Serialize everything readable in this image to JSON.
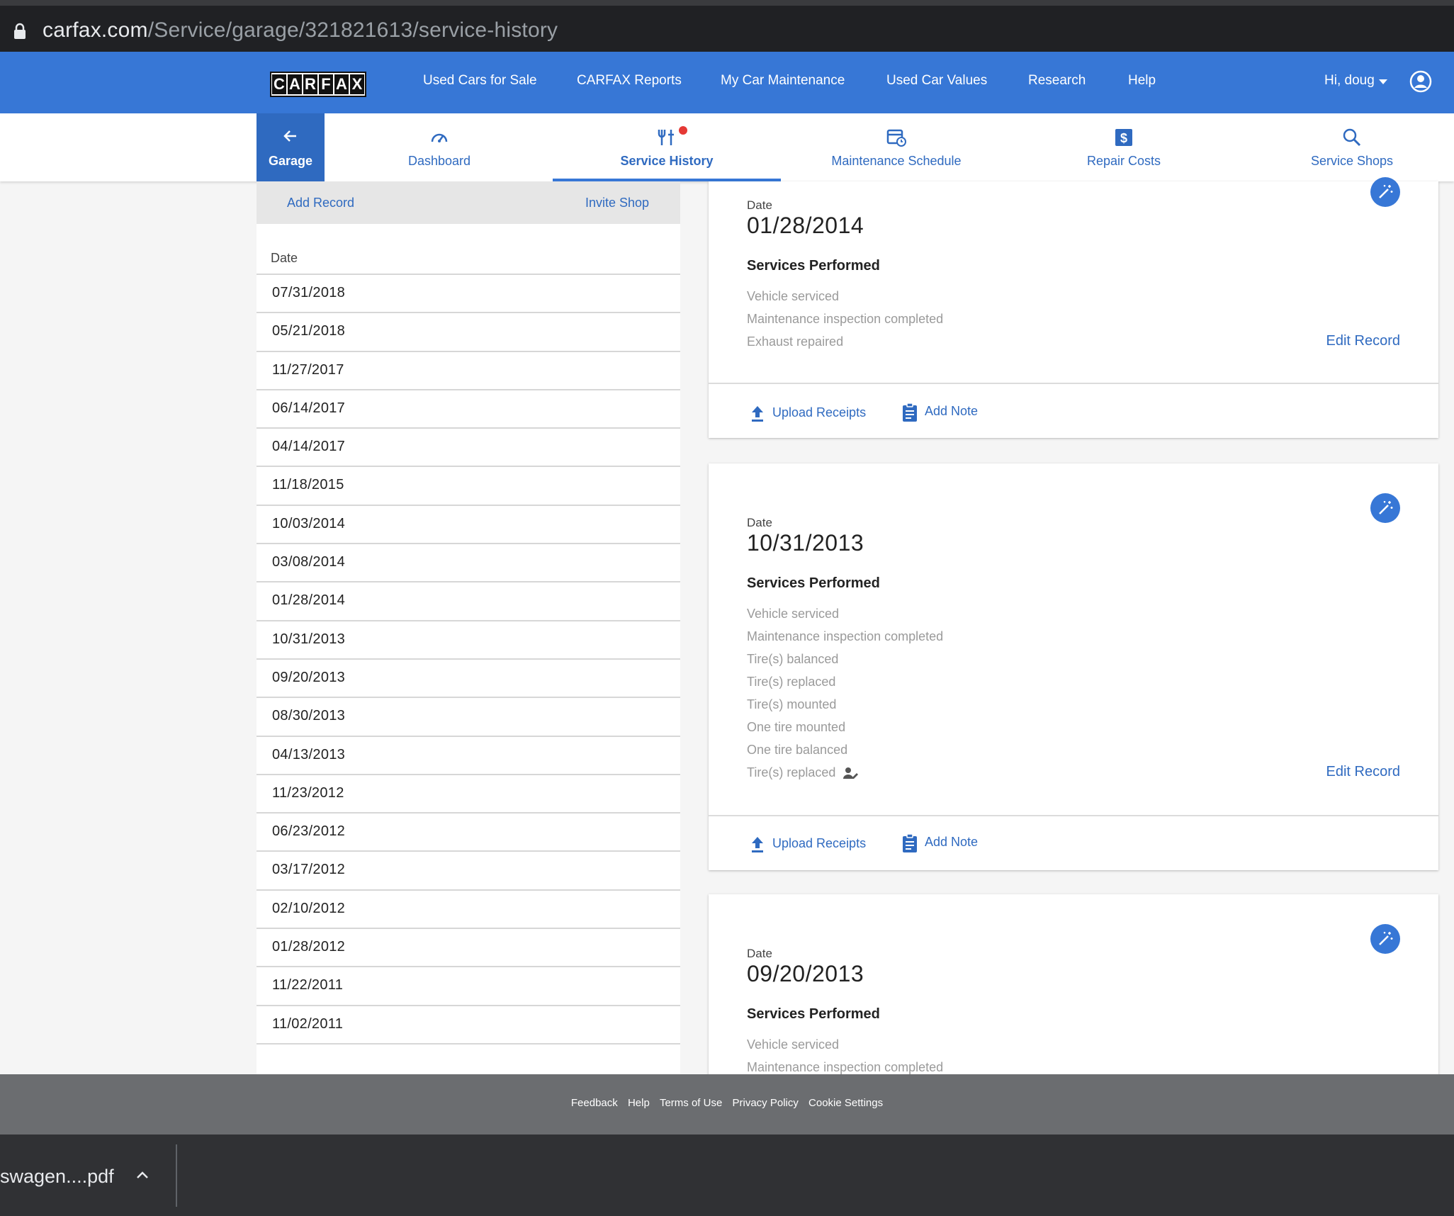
{
  "browser": {
    "url_host": "carfax.com",
    "url_path": "/Service/garage/321821613/service-history"
  },
  "topnav": {
    "logo": [
      "C",
      "A",
      "R",
      "F",
      "A",
      "X"
    ],
    "links": [
      "Used Cars for Sale",
      "CARFAX Reports",
      "My Car Maintenance",
      "Used Car Values",
      "Research",
      "Help"
    ],
    "greeting": "Hi, doug"
  },
  "subnav": {
    "garage": "Garage",
    "tabs": [
      "Dashboard",
      "Service History",
      "Maintenance Schedule",
      "Repair Costs",
      "Service Shops"
    ],
    "active_tab": "Service History"
  },
  "left_panel": {
    "add_record": "Add Record",
    "invite_shop": "Invite Shop",
    "date_header": "Date",
    "dates": [
      "07/31/2018",
      "05/21/2018",
      "11/27/2017",
      "06/14/2017",
      "04/14/2017",
      "11/18/2015",
      "10/03/2014",
      "03/08/2014",
      "01/28/2014",
      "10/31/2013",
      "09/20/2013",
      "08/30/2013",
      "04/13/2013",
      "11/23/2012",
      "06/23/2012",
      "03/17/2012",
      "02/10/2012",
      "01/28/2012",
      "11/22/2011",
      "11/02/2011"
    ]
  },
  "records": [
    {
      "date_label": "Date",
      "date": "01/28/2014",
      "services_title": "Services Performed",
      "services": [
        "Vehicle serviced",
        "Maintenance inspection completed",
        "Exhaust repaired"
      ],
      "edit": "Edit Record",
      "upload": "Upload Receipts",
      "note": "Add Note"
    },
    {
      "date_label": "Date",
      "date": "10/31/2013",
      "services_title": "Services Performed",
      "services": [
        "Vehicle serviced",
        "Maintenance inspection completed",
        "Tire(s) balanced",
        "Tire(s) replaced",
        "Tire(s) mounted",
        "One tire mounted",
        "One tire balanced",
        "Tire(s) replaced"
      ],
      "edit": "Edit Record",
      "upload": "Upload Receipts",
      "note": "Add Note"
    },
    {
      "date_label": "Date",
      "date": "09/20/2013",
      "services_title": "Services Performed",
      "services": [
        "Vehicle serviced",
        "Maintenance inspection completed"
      ]
    }
  ],
  "footer": {
    "links": [
      "Feedback",
      "Help",
      "Terms of Use",
      "Privacy Policy",
      "Cookie Settings"
    ]
  },
  "downloads": {
    "file": "swagen....pdf"
  },
  "colors": {
    "brand_blue": "#3777d6",
    "link_blue": "#2f6ac0",
    "badge_red": "#e53935"
  }
}
